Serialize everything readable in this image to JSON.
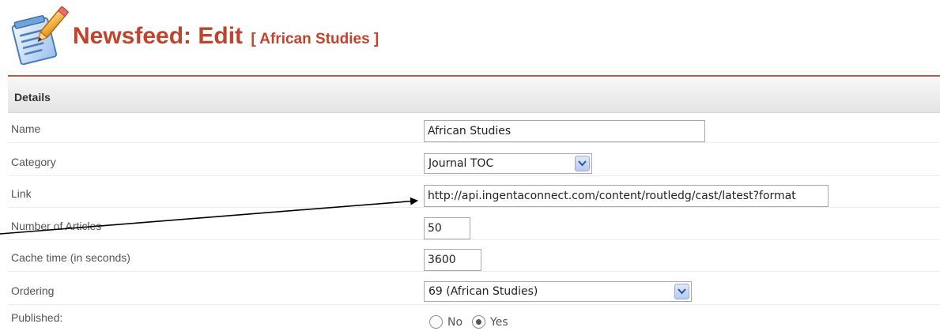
{
  "header": {
    "title": "Newsfeed: Edit",
    "subtitle": "[ African Studies ]"
  },
  "details": {
    "section_label": "Details",
    "name": {
      "label": "Name",
      "value": "African Studies"
    },
    "category": {
      "label": "Category",
      "selected": "Journal TOC"
    },
    "link": {
      "label": "Link",
      "value": "http://api.ingentaconnect.com/content/routledg/cast/latest?format"
    },
    "num_articles": {
      "label": "Number of Articles",
      "value": "50"
    },
    "cache_time": {
      "label": "Cache time (in seconds)",
      "value": "3600"
    },
    "ordering": {
      "label": "Ordering",
      "selected": "69 (African Studies)"
    },
    "published": {
      "label": "Published:",
      "options": [
        "No",
        "Yes"
      ],
      "selected": "Yes"
    }
  },
  "colors": {
    "title": "#c2432c",
    "rule": "#c2564a"
  }
}
